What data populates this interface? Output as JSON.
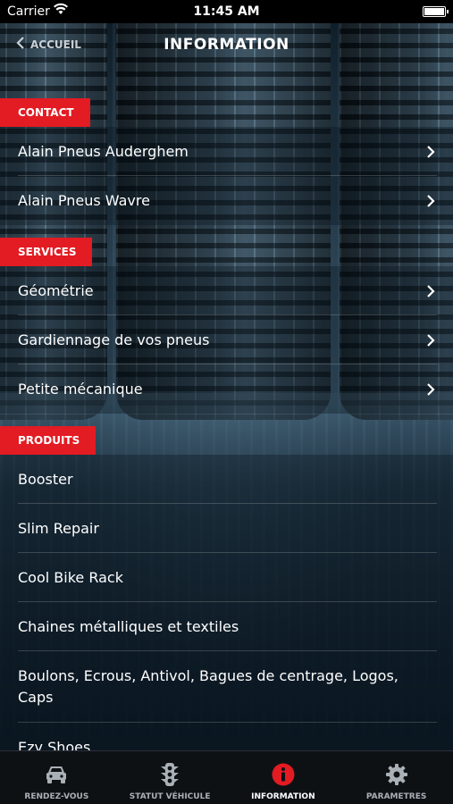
{
  "status_bar": {
    "carrier": "Carrier",
    "time": "11:45 AM"
  },
  "navbar": {
    "back_label": "ACCUEIL",
    "title": "INFORMATION"
  },
  "sections": [
    {
      "header": "CONTACT",
      "items": [
        "Alain Pneus Auderghem",
        "Alain Pneus Wavre"
      ]
    },
    {
      "header": "SERVICES",
      "items": [
        "Géométrie",
        "Gardiennage de vos pneus",
        "Petite mécanique"
      ]
    },
    {
      "header": "PRODUITS",
      "items": [
        "Booster",
        "Slim Repair",
        "Cool Bike Rack",
        "Chaines métalliques et textiles",
        "Boulons, Ecrous, Antivol, Bagues de centrage, Logos, Caps",
        "Ezy Shoes"
      ]
    }
  ],
  "tabbar": {
    "tabs": [
      {
        "label": "RENDEZ-VOUS",
        "icon": "car-icon"
      },
      {
        "label": "STATUT VÉHICULE",
        "icon": "traffic-light-icon"
      },
      {
        "label": "INFORMATION",
        "icon": "info-icon",
        "active": true
      },
      {
        "label": "PARAMETRES",
        "icon": "gear-icon"
      }
    ]
  },
  "colors": {
    "accent": "#e31b23",
    "tabbar_bg": "#0e1114",
    "text": "#ffffff"
  }
}
